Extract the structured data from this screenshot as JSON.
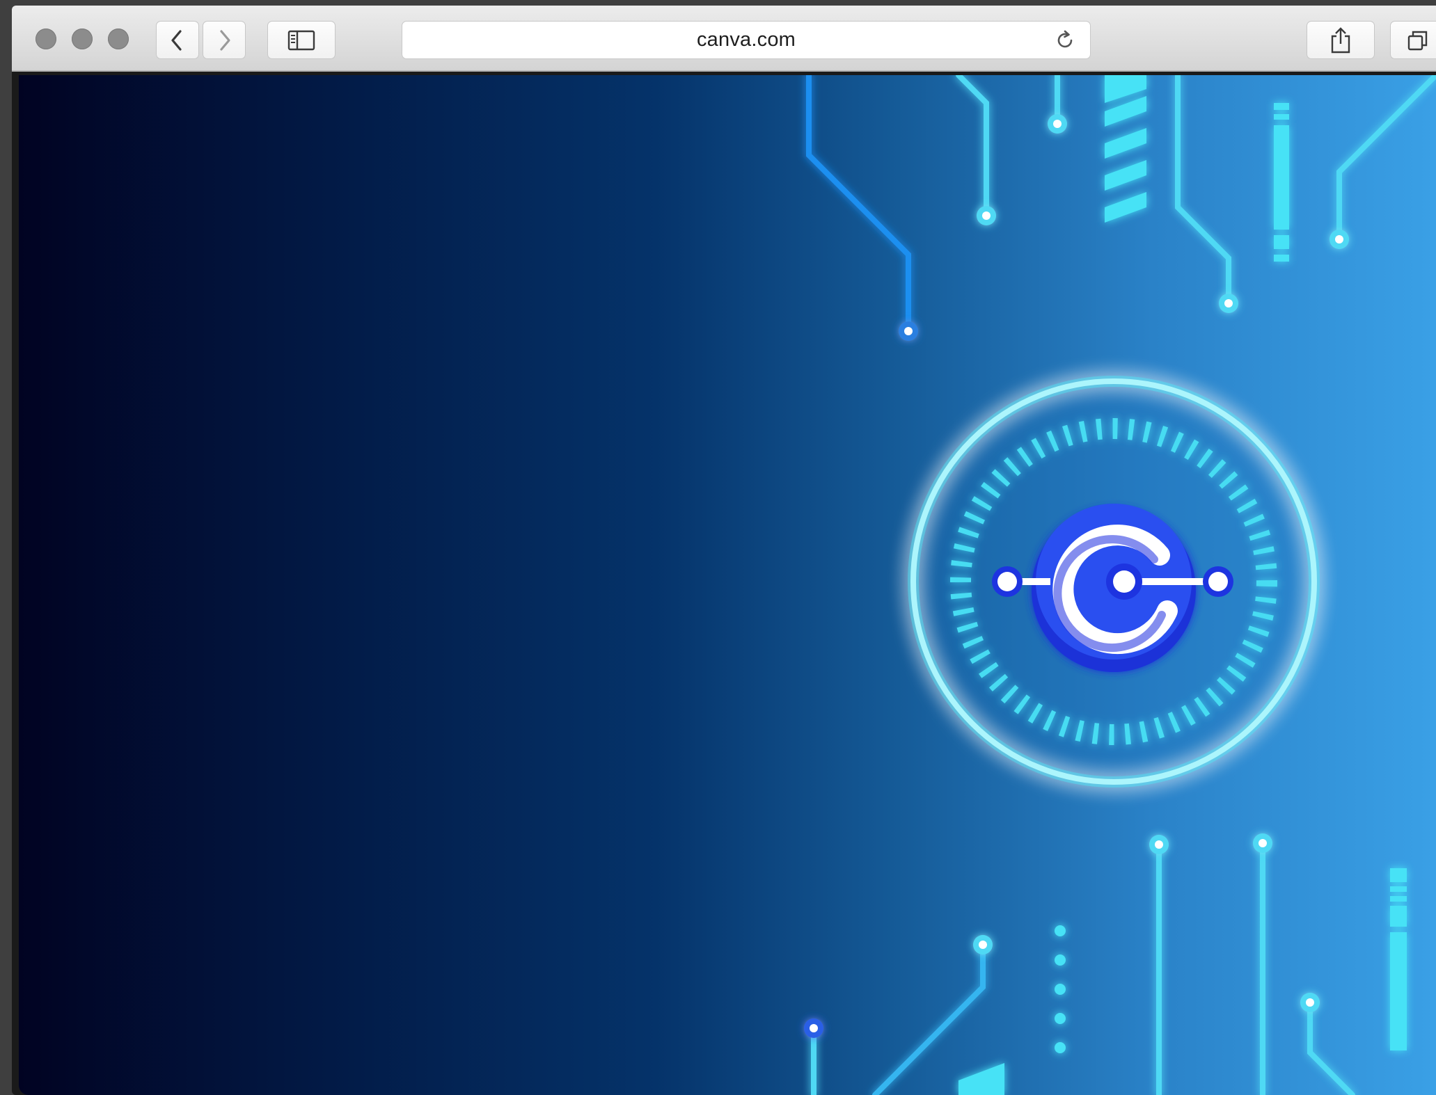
{
  "browser": {
    "url": "canva.com",
    "buttons": {
      "back": "chevron-left-icon",
      "forward": "chevron-right-icon",
      "sidebar": "sidebar-icon",
      "reload": "reload-icon",
      "share": "share-icon",
      "tabs": "tabs-icon"
    }
  },
  "page": {
    "background_gradient": [
      "#010322",
      "#05336a",
      "#3aa0e6"
    ],
    "circuit_color": "#3fe6f6",
    "emblem_icon": "circuit-c-logo-icon"
  }
}
